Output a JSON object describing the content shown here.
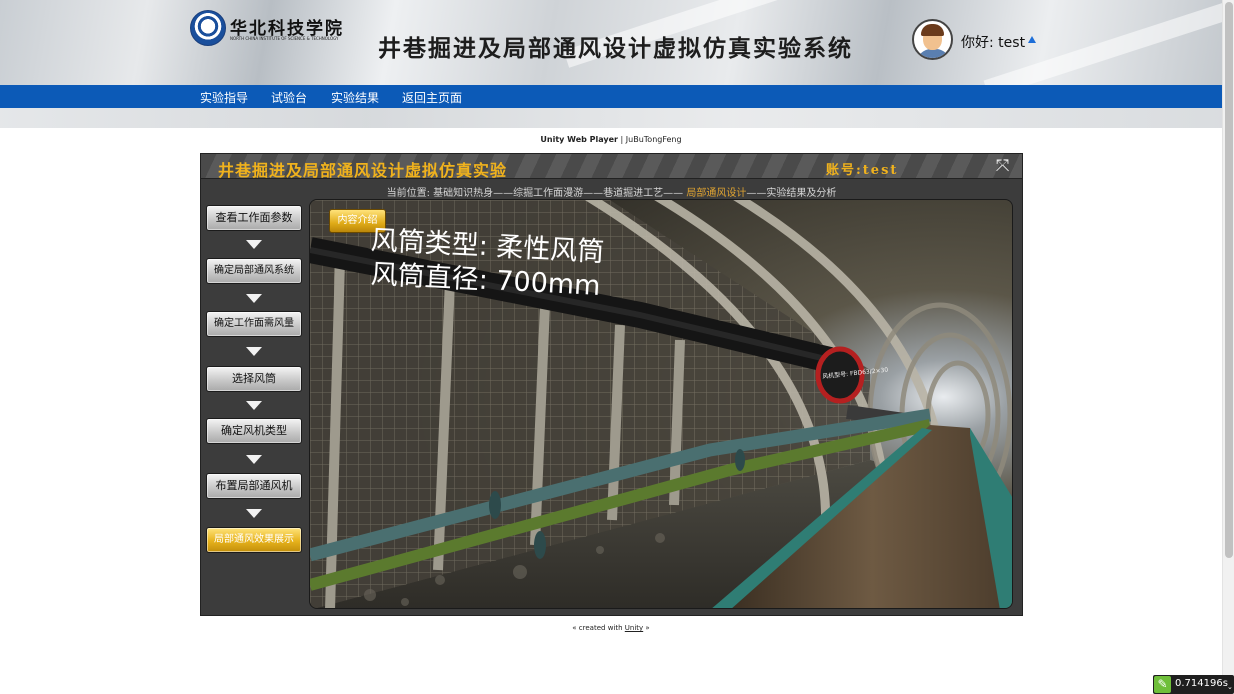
{
  "header": {
    "logo_cn": "华北科技学院",
    "logo_en": "NORTH CHINA INSTITUTE OF SCIENCE & TECHNOLOGY",
    "system_title": "井巷掘进及局部通风设计虚拟仿真实验系统",
    "greeting": "你好: test"
  },
  "nav": {
    "items": [
      {
        "label": "实验指导"
      },
      {
        "label": "试验台"
      },
      {
        "label": "实验结果"
      },
      {
        "label": "返回主页面"
      }
    ]
  },
  "player": {
    "title_bold": "Unity Web Player",
    "title_rest": " | JuBuTongFeng"
  },
  "unity": {
    "title": "井巷掘进及局部通风设计虚拟仿真实验",
    "account": "账号:test",
    "fullscreen_icon": "expand-icon",
    "breadcrumb": {
      "prefix": "当前位置: 基础知识热身——综掘工作面漫游——巷道掘进工艺—— ",
      "current": "局部通风设计",
      "suffix": "——实验结果及分析"
    },
    "steps": [
      {
        "label": "查看工作面参数",
        "active": false
      },
      {
        "label": "确定局部通风系统",
        "active": false
      },
      {
        "label": "确定工作面需风量",
        "active": false
      },
      {
        "label": "选择风筒",
        "active": false
      },
      {
        "label": "确定风机类型",
        "active": false
      },
      {
        "label": "布置局部通风机",
        "active": false
      },
      {
        "label": "局部通风效果展示",
        "active": true
      }
    ],
    "scene": {
      "intro_button": "内容介绍",
      "duct_type": "风筒类型: 柔性风筒",
      "duct_diameter": "风筒直径: 700mm",
      "fan_label": "风机型号: FBD63/2×30"
    }
  },
  "footer": {
    "created_prefix": "« created with ",
    "created_link": "Unity",
    "created_suffix": " »"
  },
  "timer": {
    "value": "0.714196s"
  },
  "colors": {
    "nav_blue": "#0c5ab7",
    "gold": "#f0b21d",
    "active_step": "#e6b21c"
  }
}
